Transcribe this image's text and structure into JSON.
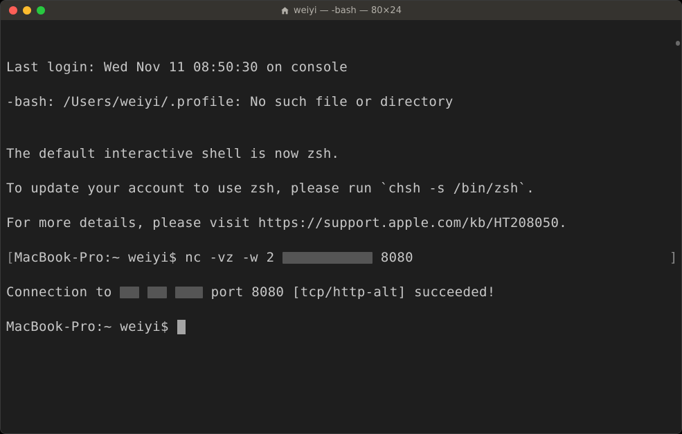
{
  "window": {
    "title": "weiyi — -bash — 80×24"
  },
  "terminal": {
    "line1": "Last login: Wed Nov 11 08:50:30 on console",
    "line2": "-bash: /Users/weiyi/.profile: No such file or directory",
    "blank": "",
    "line3": "The default interactive shell is now zsh.",
    "line4": "To update your account to use zsh, please run `chsh -s /bin/zsh`.",
    "line5": "For more details, please visit https://support.apple.com/kb/HT208050.",
    "prompt1_a": "MacBook-Pro:~ weiyi$ nc -vz -w 2 ",
    "prompt1_b": " 8080",
    "result_a": "Connection to ",
    "result_b": " port 8080 [tcp/http-alt] succeeded!",
    "prompt2": "MacBook-Pro:~ weiyi$ "
  }
}
